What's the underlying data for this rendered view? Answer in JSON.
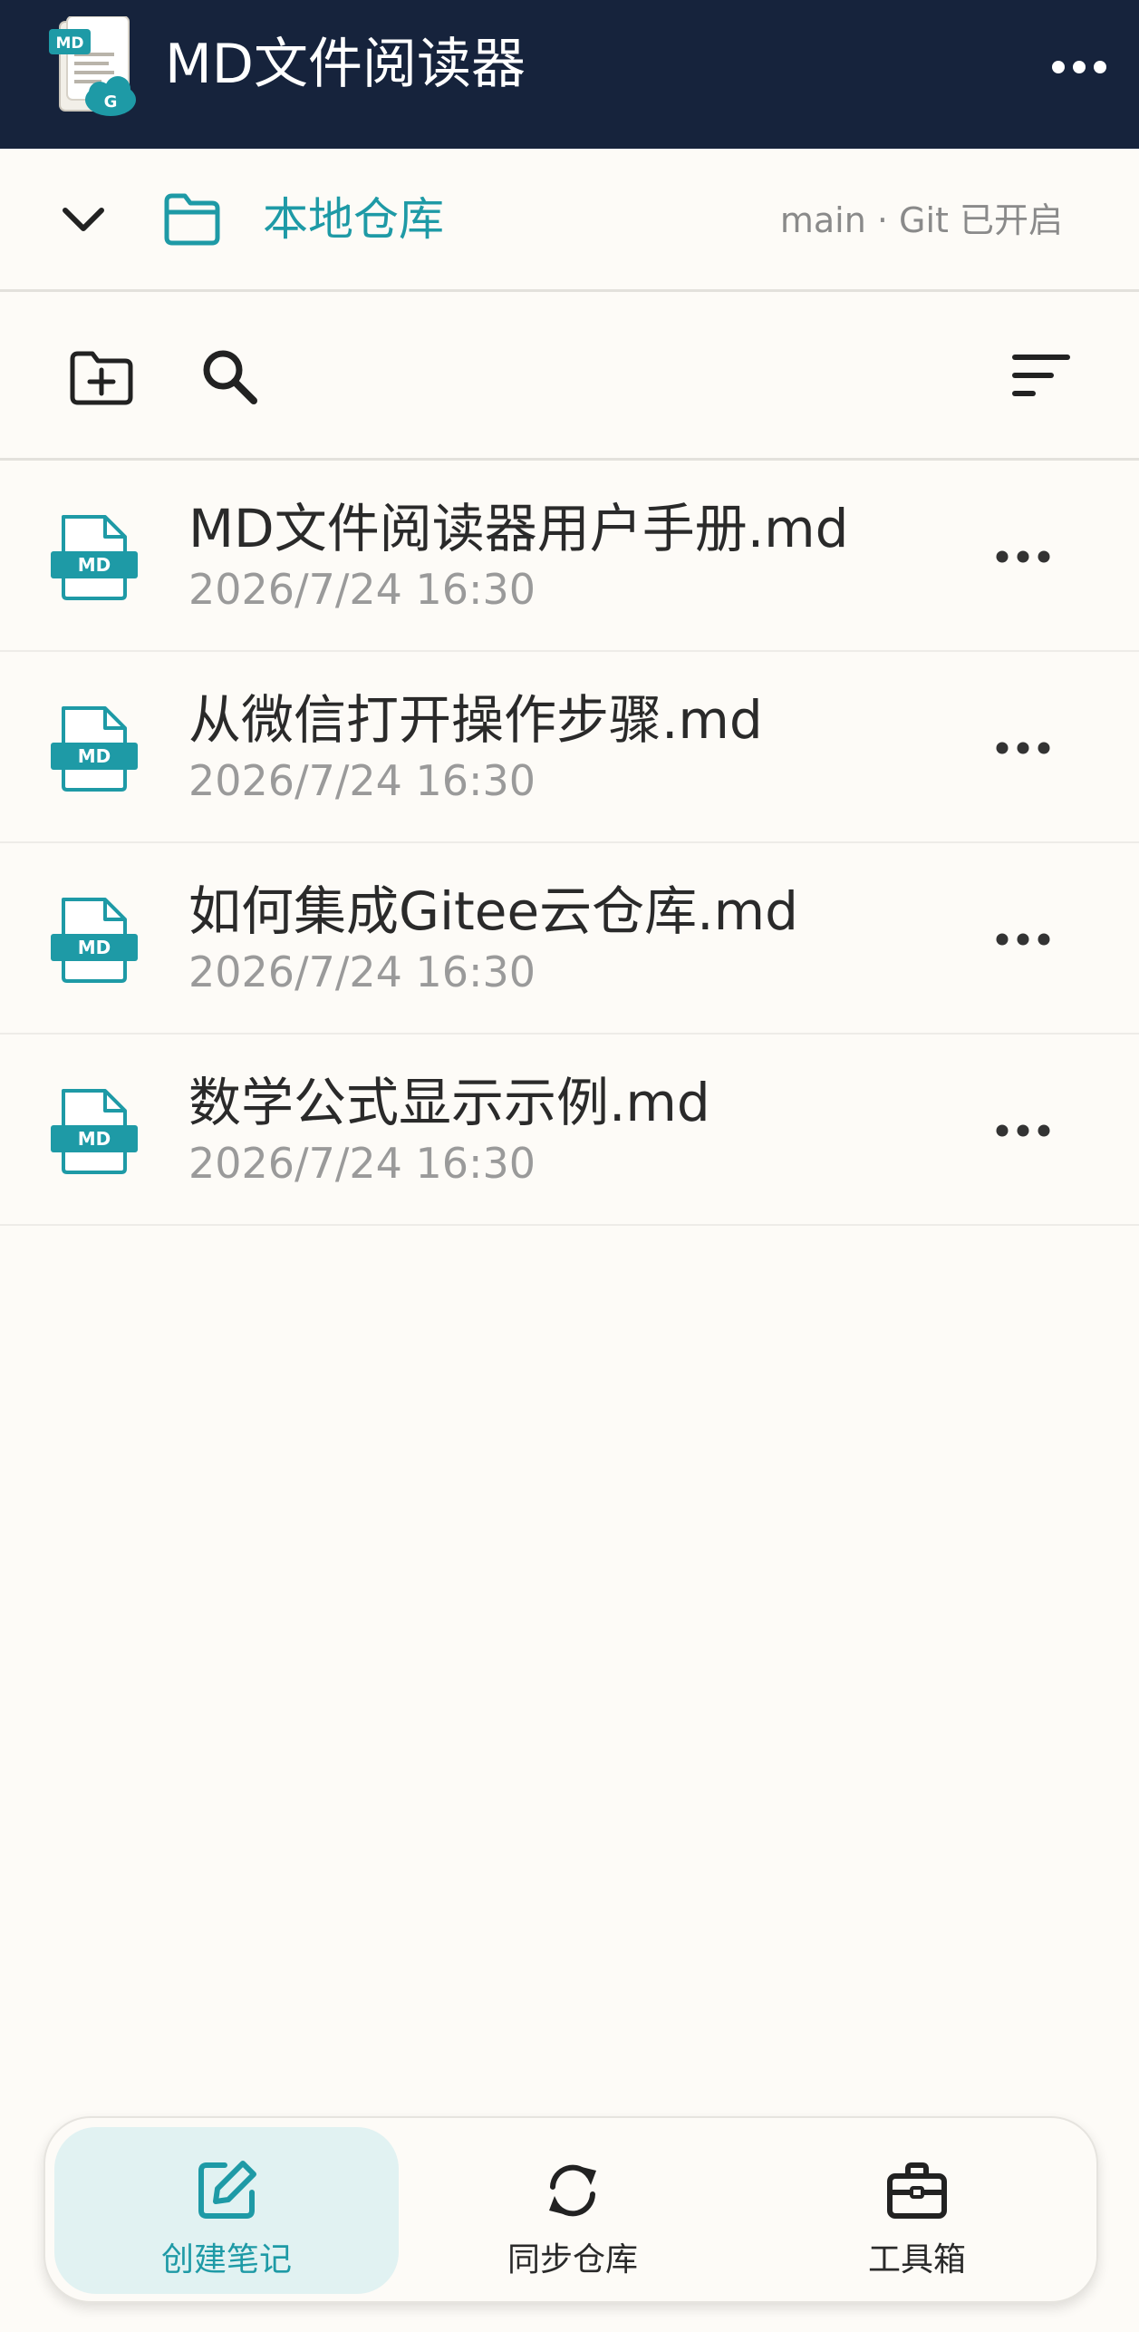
{
  "app": {
    "title": "MD文件阅读器",
    "logo_icon": "md-gitee-app-logo",
    "menu_icon": "more-horizontal-icon"
  },
  "repo": {
    "name": "本地仓库",
    "status": "main · Git 已开启",
    "expand_icon": "chevron-down-icon",
    "folder_icon": "folder-icon"
  },
  "toolbar": {
    "new_folder_icon": "folder-add-icon",
    "search_icon": "search-icon",
    "sort_icon": "sort-icon"
  },
  "files": [
    {
      "name": "MD文件阅读器用户手册.md",
      "time": "2026/7/24 16:30"
    },
    {
      "name": "从微信打开操作步骤.md",
      "time": "2026/7/24 16:30"
    },
    {
      "name": "如何集成Gitee云仓库.md",
      "time": "2026/7/24 16:30"
    },
    {
      "name": "数学公式显示示例.md",
      "time": "2026/7/24 16:30"
    }
  ],
  "file_icon_label": "MD",
  "bottom_nav": {
    "create": {
      "label": "创建笔记",
      "icon": "edit-note-icon",
      "active": true
    },
    "sync": {
      "label": "同步仓库",
      "icon": "sync-icon",
      "active": false
    },
    "tools": {
      "label": "工具箱",
      "icon": "toolbox-icon",
      "active": false
    }
  },
  "colors": {
    "appbar_bg": "#16233c",
    "accent": "#1e9aa6",
    "background": "#fdfbf7",
    "active_nav_bg": "#e1f2f2"
  }
}
